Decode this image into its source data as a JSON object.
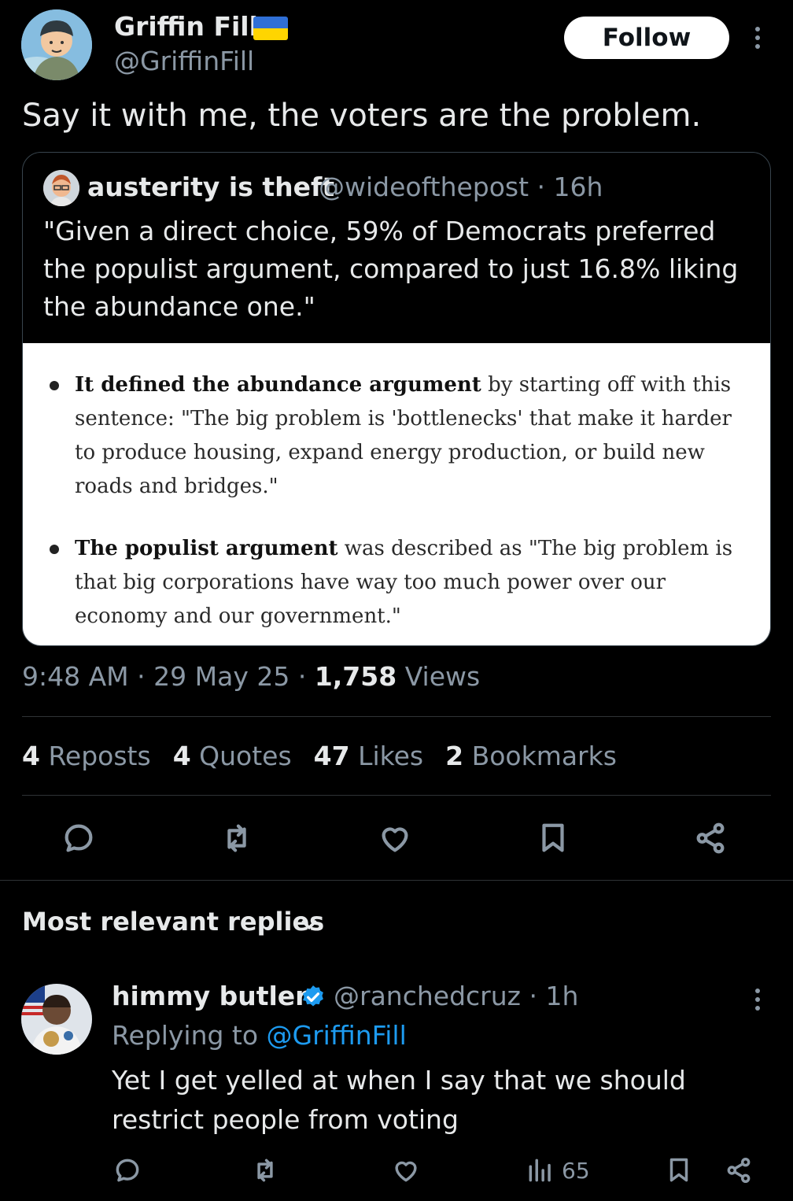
{
  "post": {
    "author_name": "Griffin Fill",
    "author_handle": "@GriffinFill",
    "follow_label": "Follow",
    "text": "Say it with me, the voters are the problem.",
    "time": "9:48 AM",
    "date": "29 May 25",
    "views_count": "1,758",
    "views_label": "Views"
  },
  "quote": {
    "name": "austerity is theft",
    "handle": "@wideofthepost",
    "age": "16h",
    "text": "\"Given a direct choice, 59% of Democrats preferred the populist argument, compared to just 16.8% liking the abundance one.\"",
    "image": {
      "bullet_1_bold": "It defined the abundance argument",
      "bullet_1_rest": " by starting off with this sentence: \"The big problem is 'bottlenecks' that make it harder to produce housing, expand energy production, or build new roads and bridges.\"",
      "bullet_2_bold": "The populist argument",
      "bullet_2_rest": " was described as \"The big problem is that big corporations have way too much power over our economy and our government.\""
    }
  },
  "stats": {
    "reposts_count": "4",
    "reposts_label": "Reposts",
    "quotes_count": "4",
    "quotes_label": "Quotes",
    "likes_count": "47",
    "likes_label": "Likes",
    "bookmarks_count": "2",
    "bookmarks_label": "Bookmarks"
  },
  "replies_header": "Most relevant replies",
  "reply": {
    "name": "himmy butler",
    "handle": "@ranchedcruz",
    "age": "1h",
    "replying_prefix": "Replying to ",
    "replying_handle": "@GriffinFill",
    "text": "Yet I get yelled at when I say that we should restrict people from voting",
    "views": "65"
  },
  "colors": {
    "background": "#000000",
    "text": "#e7e9ea",
    "muted": "#8b98a5",
    "link": "#1d9bf0",
    "flag_blue": "#2f6fd6",
    "flag_yellow": "#ffd500"
  },
  "icons": [
    "reply-icon",
    "repost-icon",
    "like-icon",
    "bookmark-icon",
    "share-icon",
    "views-icon",
    "verified-icon",
    "chevron-down-icon",
    "more-icon"
  ]
}
